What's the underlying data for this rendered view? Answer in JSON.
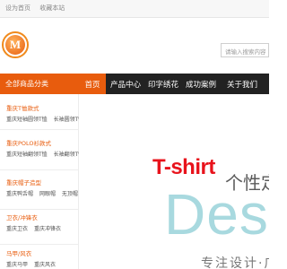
{
  "topbar": {
    "links": [
      "设为首页",
      "收藏本站"
    ]
  },
  "header": {
    "logo_letter": "M",
    "search": {
      "placeholder": "请输入搜索内容"
    }
  },
  "nav": {
    "category_label": "全部商品分类",
    "items": [
      "首页",
      "产品中心",
      "印字绣花",
      "成功案例",
      "关于我们"
    ]
  },
  "sidebar": {
    "categories": [
      {
        "title": "重庆T恤款式",
        "subs": [
          "重庆短袖圆领T恤",
          "长袖圆领T恤"
        ]
      },
      {
        "title": "重庆POLO衫款式",
        "subs": [
          "重庆短袖翻领T恤",
          "长袖翻领T恤"
        ]
      },
      {
        "title": "重庆帽子造型",
        "subs": [
          "重庆鸭舌帽",
          "网眼帽",
          "无顶帽"
        ]
      },
      {
        "title": "卫衣/冲锋衣",
        "subs": [
          "重庆卫衣",
          "重庆冲锋衣"
        ]
      },
      {
        "title": "马甲/风衣",
        "subs": [
          "重庆马甲",
          "重庆风衣"
        ]
      }
    ]
  },
  "banner": {
    "headline": "T-shirt",
    "subheadline": "个性定制",
    "design_word": "Design",
    "tagline": "专注设计·广告衫·文化衫定制"
  },
  "colors": {
    "accent": "#e85c0d",
    "nav_bg": "#222222",
    "headline_red": "#e8131c",
    "design_teal": "#a8d9df"
  }
}
